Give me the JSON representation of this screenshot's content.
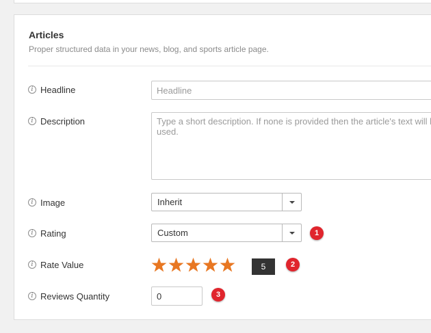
{
  "section": {
    "title": "Articles",
    "description": "Proper structured data in your news, blog, and sports article page."
  },
  "icons": {
    "info": "i",
    "info_name": "info-icon",
    "star_name": "star-icon"
  },
  "fields": {
    "headline": {
      "label": "Headline",
      "placeholder": "Headline",
      "value": ""
    },
    "description": {
      "label": "Description",
      "placeholder": "Type a short description. If none is provided then the article's text will be used.",
      "value": ""
    },
    "image": {
      "label": "Image",
      "value": "Inherit"
    },
    "rating": {
      "label": "Rating",
      "value": "Custom"
    },
    "rate_value": {
      "label": "Rate Value",
      "value": "5",
      "stars_filled": 5,
      "stars_total": 5
    },
    "reviews_quantity": {
      "label": "Reviews Quantity",
      "value": "0"
    }
  },
  "badges": {
    "one": "1",
    "two": "2",
    "three": "3"
  },
  "colors": {
    "star": "#e87722",
    "badge": "#e0252d",
    "rate_box": "#333333"
  }
}
